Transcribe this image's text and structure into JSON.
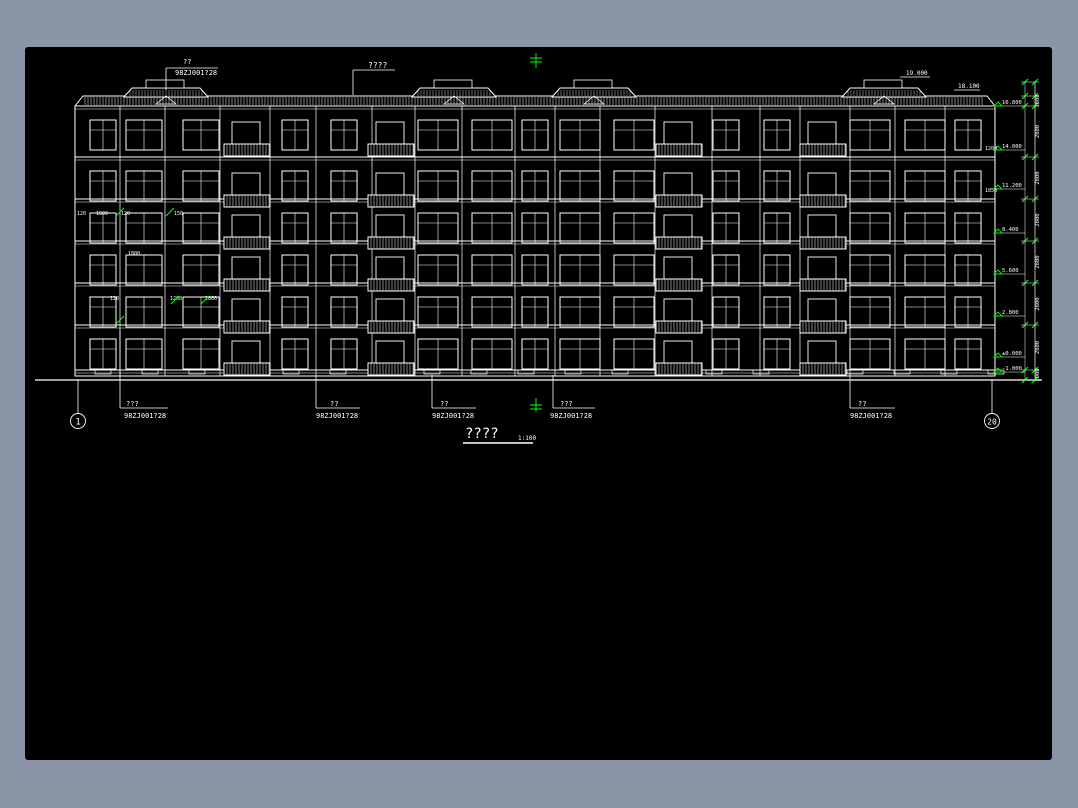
{
  "drawing": {
    "title": "????",
    "scale": "1:100",
    "ridge_label": "????",
    "axis_left": "1",
    "axis_right": "20"
  },
  "callouts": [
    {
      "mark": "??",
      "ref": "98ZJ001?28"
    },
    {
      "mark": "???",
      "ref": "98ZJ001?28"
    },
    {
      "mark": "??",
      "ref": "98ZJ001?28"
    },
    {
      "mark": "??",
      "ref": "98ZJ001?28"
    },
    {
      "mark": "???",
      "ref": "98ZJ001?28"
    },
    {
      "mark": "??",
      "ref": "98ZJ001?28"
    }
  ],
  "elevations": [
    "18.100",
    "16.800",
    "14.000",
    "11.200",
    "8.400",
    "5.600",
    "2.800",
    "±0.000",
    "-1.000"
  ],
  "dimensions": [
    "1800",
    "2800",
    "2800",
    "2800",
    "2800",
    "2800",
    "2800",
    "1000"
  ],
  "annotations": [
    "19.000",
    "120",
    "1800",
    "120",
    "150",
    "1800",
    "120",
    "1200",
    "2800",
    "1200",
    "1850"
  ],
  "colors": {
    "background": "#000000",
    "line": "#ffffff",
    "dim": "#00ff00",
    "frame": "#8a96a8"
  }
}
